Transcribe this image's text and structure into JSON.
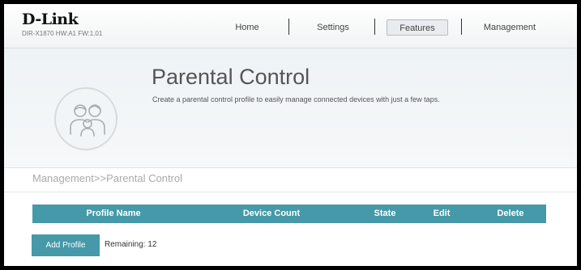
{
  "header": {
    "logo": "D-Link",
    "device_info": "DIR-X1870 HW:A1 FW:1.01",
    "nav": [
      {
        "label": "Home",
        "active": false
      },
      {
        "label": "Settings",
        "active": false
      },
      {
        "label": "Features",
        "active": true
      },
      {
        "label": "Management",
        "active": false
      }
    ]
  },
  "banner": {
    "icon": "family-icon",
    "title": "Parental Control",
    "description": "Create a parental control profile to easily manage connected devices with just a few taps."
  },
  "breadcrumb": "Management>>Parental Control",
  "table": {
    "columns": [
      "Profile Name",
      "Device Count",
      "State",
      "Edit",
      "Delete"
    ],
    "rows": []
  },
  "actions": {
    "add_profile_label": "Add Profile",
    "remaining_label": "Remaining:",
    "remaining_count": "12"
  },
  "colors": {
    "accent": "#4599a9",
    "title_text": "#555555"
  }
}
